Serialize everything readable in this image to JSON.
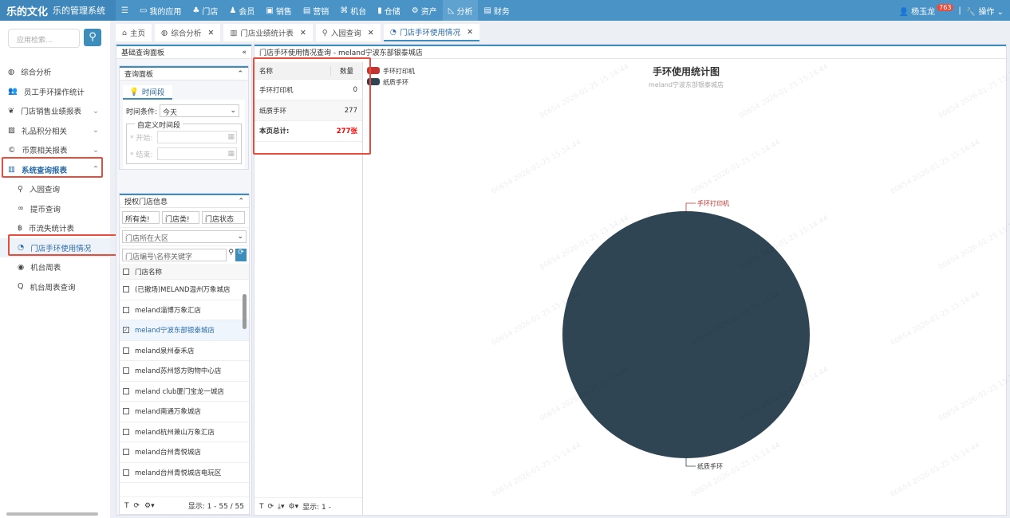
{
  "header": {
    "logo": "乐的文化",
    "system": "乐的管理系统",
    "nav": [
      "我的应用",
      "门店",
      "会员",
      "销售",
      "营销",
      "机台",
      "仓储",
      "资产",
      "分析",
      "财务"
    ],
    "active": "分析",
    "user": "杨玉龙",
    "badge": "763",
    "ops": "操作"
  },
  "sidebar": {
    "search_placeholder": "应用检索...",
    "items": [
      {
        "label": "综合分析",
        "icon": "dashboard-icon"
      },
      {
        "label": "员工手环操作统计",
        "icon": "users-icon"
      },
      {
        "label": "门店销售业绩报表",
        "icon": "leaf-icon",
        "chev": "⌄"
      },
      {
        "label": "礼品积分相关",
        "icon": "gift-icon",
        "chev": "⌄"
      },
      {
        "label": "币票相关报表",
        "icon": "coin-icon",
        "chev": "⌄"
      },
      {
        "label": "系统查询报表",
        "icon": "bar-chart-icon",
        "chev": "⌃"
      }
    ],
    "subitems": [
      {
        "label": "入园查询"
      },
      {
        "label": "提币查询"
      },
      {
        "label": "币流失统计表"
      },
      {
        "label": "门店手环使用情况"
      },
      {
        "label": "机台周表"
      },
      {
        "label": "机台周表查询"
      }
    ]
  },
  "tabs": [
    {
      "label": "主页"
    },
    {
      "label": "综合分析"
    },
    {
      "label": "门店业绩统计表"
    },
    {
      "label": "入园查询"
    },
    {
      "label": "门店手环使用情况"
    }
  ],
  "query": {
    "title": "基础查询面板",
    "panel": "查询面板",
    "tab": "时间段",
    "cond_label": "时间条件:",
    "cond_value": "今天",
    "custom": "自定义时间段",
    "start": "* 开始:",
    "end": "* 结束:"
  },
  "stores": {
    "title": "授权门店信息",
    "f1": "所有类!",
    "f2": "门店类!",
    "f3": "门店状态",
    "region": "门店所在大区",
    "kw_placeholder": "门店编号\\名称关键字",
    "col": "门店名称",
    "rows": [
      {
        "name": "(已撤场)MELAND温州万象城店",
        "checked": false
      },
      {
        "name": "meland淄博万象汇店",
        "checked": false
      },
      {
        "name": "meland宁波东部银泰城店",
        "checked": true
      },
      {
        "name": "meland泉州泰禾店",
        "checked": false
      },
      {
        "name": "meland苏州悠方购物中心店",
        "checked": false
      },
      {
        "name": "meland club厦门宝龙一城店",
        "checked": false
      },
      {
        "name": "meland南通万象城店",
        "checked": false
      },
      {
        "name": "meland杭州萧山万象汇店",
        "checked": false
      },
      {
        "name": "meland台州青悦城店",
        "checked": false
      },
      {
        "name": "meland台州青悦城店电玩区",
        "checked": false
      }
    ],
    "pager": "显示: 1 - 55 / 55"
  },
  "result": {
    "title": "门店手环使用情况查询 - meland宁波东部银泰城店",
    "col_name": "名称",
    "col_qty": "数量",
    "rows": [
      {
        "name": "手环打印机",
        "qty": "0"
      },
      {
        "name": "纸质手环",
        "qty": "277"
      }
    ],
    "total_label": "本页总计:",
    "total": "277张",
    "pager": "显示: 1 -"
  },
  "watermark": "00654  2026-01-25 15:14:44",
  "chart_data": {
    "type": "pie",
    "title": "手环使用统计图",
    "subtitle": "meland宁波东部银泰城店",
    "categories": [
      "手环打印机",
      "纸质手环"
    ],
    "values": [
      0,
      277
    ],
    "colors": [
      "#c23531",
      "#2f4554"
    ],
    "legend": "top-left"
  }
}
